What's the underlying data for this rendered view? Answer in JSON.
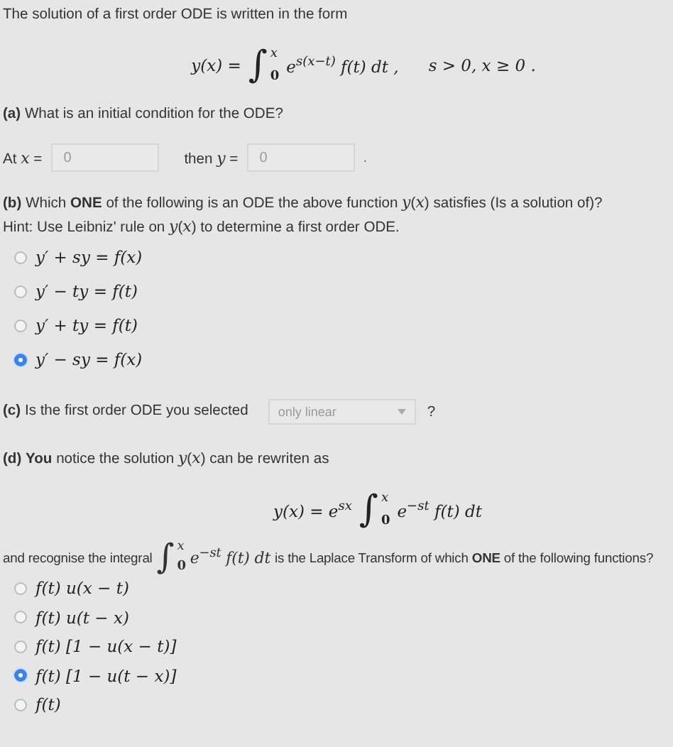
{
  "intro": "The solution of a first order ODE is written in the form",
  "formula_1": {
    "lhs": "y(x) =",
    "integral": {
      "sign": "∫",
      "upper": "x",
      "lower": "0"
    },
    "integrand": "e$^{s(x−t)}$ f(t) dt ,",
    "condition": "s > 0, x ≥ 0 ."
  },
  "part_a": {
    "question": "**(a)** What is an initial condition for the ODE?",
    "prefix": "At *x* =",
    "field_1": {
      "value": "0"
    },
    "middle": "then *y* =",
    "field_2": {
      "value": "0"
    },
    "suffix": "."
  },
  "part_b": {
    "question": "**(b)** Which **ONE** of the following is an ODE the above function *y*(*x*) satisfies (Is a solution of)?",
    "hint": "Hint: Use Leibniz' rule on *y*(*x*) to determine a first order ODE.",
    "options": [
      {
        "label": "y′ + sy = f(x)",
        "selected": false
      },
      {
        "label": "y′ − ty = f(t)",
        "selected": false
      },
      {
        "label": "y′ + ty = f(t)",
        "selected": false
      },
      {
        "label": "y′ − sy = f(x)",
        "selected": true
      }
    ]
  },
  "part_c": {
    "question": "**(c)** Is the first order ODE you selected",
    "dropdown": {
      "value": "only linear"
    },
    "suffix": "?"
  },
  "part_d": {
    "text": "**(d)** **You** notice the solution *y*(*x*) can be rewriten as",
    "formula_2": {
      "lhs": "y(x) = e$^{sx}$",
      "integral": {
        "sign": "∫",
        "upper": "x",
        "lower": "0"
      },
      "integrand": "e$^{−st}$ f(t) dt"
    },
    "sentence_start": "and recognise the integral",
    "inline_integral": {
      "sign": "∫",
      "upper": "x",
      "lower": "0"
    },
    "inline_integrand": "e$^{−st}$ f(t) dt",
    "sentence_end": "is the Laplace Transform of which **ONE** of the following functions?",
    "options": [
      {
        "label": "f(t) u(x − t)",
        "selected": false
      },
      {
        "label": "f(t) u(t − x)",
        "selected": false
      },
      {
        "label": "f(t) [1 − u(x − t)]",
        "selected": false
      },
      {
        "label": "f(t) [1 − u(t − x)]",
        "selected": true
      },
      {
        "label": "f(t)",
        "selected": false
      }
    ]
  }
}
